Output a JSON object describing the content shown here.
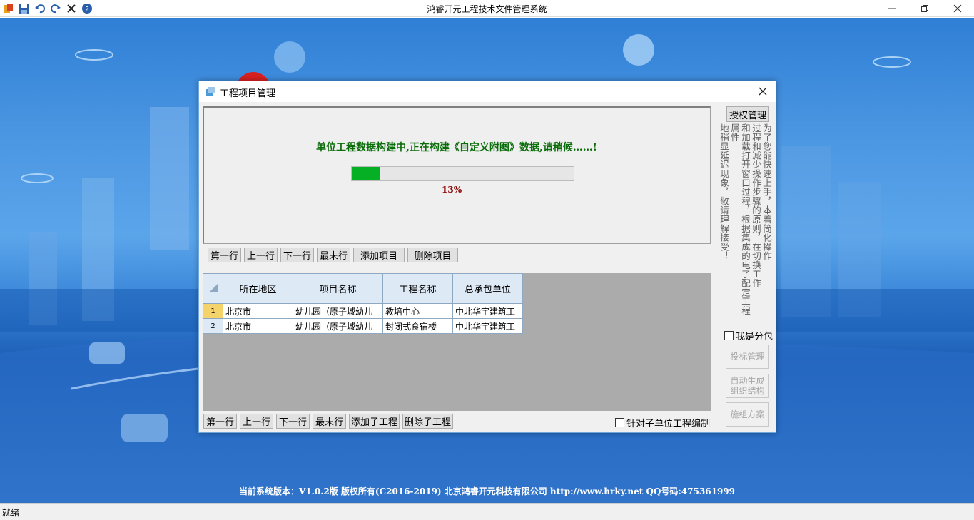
{
  "app": {
    "title": "鸿睿开元工程技术文件管理系统"
  },
  "toolbar": {
    "icons": [
      "app-logo-icon",
      "save-icon",
      "undo-icon",
      "redo-icon",
      "close-x-icon",
      "help-icon"
    ]
  },
  "dialog": {
    "title": "工程项目管理",
    "loading_text": "单位工程数据构建中,正在构建《自定义附图》数据,请稍候……!",
    "progress_percent": 13,
    "progress_label": "13%",
    "nav_top": [
      "第一行",
      "上一行",
      "下一行",
      "最末行",
      "添加项目",
      "删除项目"
    ],
    "table": {
      "columns": [
        "所在地区",
        "项目名称",
        "工程名称",
        "总承包单位"
      ],
      "rows": [
        {
          "num": "1",
          "region": "北京市",
          "project": "幼儿园（原子城幼儿",
          "engineering": "教培中心",
          "contractor": "中北华宇建筑工"
        },
        {
          "num": "2",
          "region": "北京市",
          "project": "幼儿园（原子城幼儿",
          "engineering": "封闭式食宿楼",
          "contractor": "中北华宇建筑工"
        }
      ]
    },
    "nav_bottom": [
      "第一行",
      "上一行",
      "下一行",
      "最末行",
      "添加子工程",
      "删除子工程"
    ],
    "checkbox_sub_unit": "针对子单位工程编制",
    "side": {
      "auth_button": "授权管理",
      "info_columns": [
        "为了您能快速上手，本着简化操作",
        "过程和减少操作步骤的原则，在切换工作",
        "和加载打开窗口过程，根据集成的电了配定工程属性",
        "地稍显延迟现象，敬请理解接受！"
      ],
      "checkbox_subcontract": "我是分包",
      "bid_button": "投标管理",
      "auto_build_button": "自动生成组织结构",
      "construction_button": "施组方案"
    }
  },
  "footer": {
    "text": "当前系统版本：V1.0.2版   版权所有(C2016-2019)   北京鸿睿开元科技有限公司   http://www.hrky.net QQ号码:475361999"
  },
  "status": {
    "text": "就绪"
  }
}
